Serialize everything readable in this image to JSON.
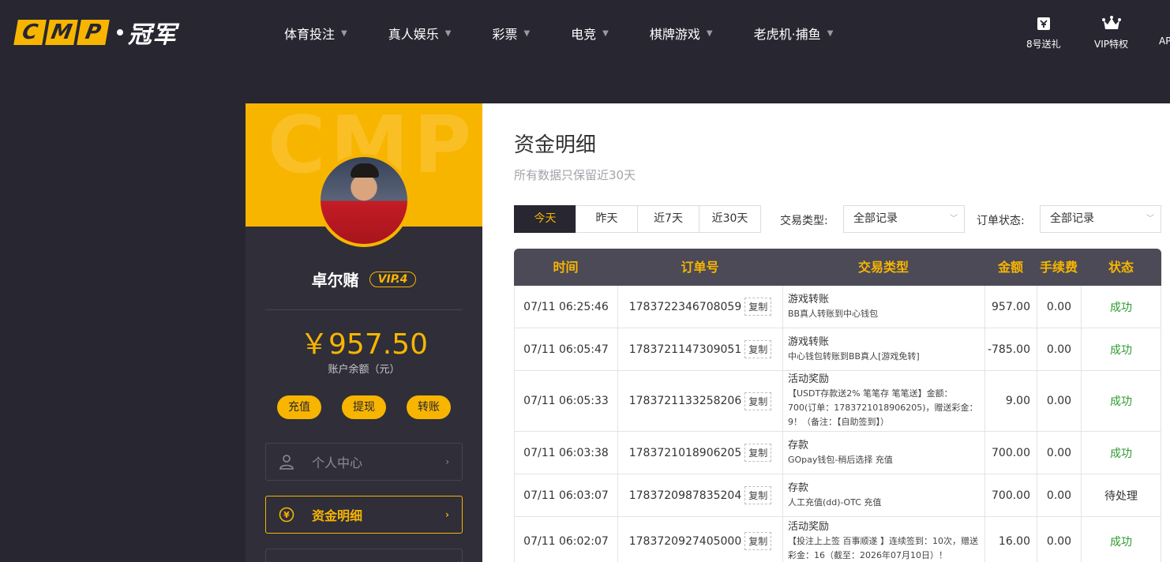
{
  "header": {
    "logo_letters": [
      "C",
      "M",
      "P"
    ],
    "logo_cn": "冠军",
    "nav": [
      {
        "label": "体育投注"
      },
      {
        "label": "真人娱乐"
      },
      {
        "label": "彩票"
      },
      {
        "label": "电竞"
      },
      {
        "label": "棋牌游戏"
      },
      {
        "label": "老虎机·捕鱼"
      }
    ],
    "icons": [
      {
        "label": "8号送礼",
        "icon": "gift-ticket-icon"
      },
      {
        "label": "VIP特权",
        "icon": "crown-icon"
      },
      {
        "label": "AP",
        "icon": "app-icon"
      }
    ]
  },
  "profile": {
    "banner_watermark": "CMP",
    "username": "卓尔赌",
    "vip": "VIP.4",
    "balance": "￥957.50",
    "balance_label": "账户余额（元）",
    "actions": [
      "充值",
      "提现",
      "转账"
    ],
    "menu": [
      {
        "label": "个人中心",
        "icon": "user-icon",
        "active": false
      },
      {
        "label": "资金明细",
        "icon": "yen-coin-icon",
        "active": true
      }
    ]
  },
  "main": {
    "title": "资金明细",
    "subtitle": "所有数据只保留近30天",
    "date_tabs": [
      "今天",
      "昨天",
      "近7天",
      "近30天"
    ],
    "active_tab": 0,
    "filters": {
      "type_label": "交易类型:",
      "type_value": "全部记录",
      "status_label": "订单状态:",
      "status_value": "全部记录"
    },
    "table": {
      "headers": [
        "时间",
        "订单号",
        "交易类型",
        "金额",
        "手续费",
        "状态"
      ],
      "copy_label": "复制",
      "rows": [
        {
          "time": "07/11 06:25:46",
          "order": "1783722346708059",
          "type": "游戏转账",
          "desc": "BB真人转账到中心钱包",
          "amount": "957.00",
          "fee": "0.00",
          "status": "成功",
          "status_kind": "ok"
        },
        {
          "time": "07/11 06:05:47",
          "order": "1783721147309051",
          "type": "游戏转账",
          "desc": "中心钱包转账到BB真人[游戏免转]",
          "amount": "-785.00",
          "fee": "0.00",
          "status": "成功",
          "status_kind": "ok"
        },
        {
          "time": "07/11 06:05:33",
          "order": "1783721133258206",
          "type": "活动奖励",
          "desc": "【USDT存款送2% 笔笔存 笔笔送】金额：700(订单：1783721018906205)，赠送彩金：9！（备注：【自助签到】）",
          "amount": "9.00",
          "fee": "0.00",
          "status": "成功",
          "status_kind": "ok"
        },
        {
          "time": "07/11 06:03:38",
          "order": "1783721018906205",
          "type": "存款",
          "desc": "GOpay钱包-稍后选择 充值",
          "amount": "700.00",
          "fee": "0.00",
          "status": "成功",
          "status_kind": "ok"
        },
        {
          "time": "07/11 06:03:07",
          "order": "1783720987835204",
          "type": "存款",
          "desc": "人工充值(dd)-OTC 充值",
          "amount": "700.00",
          "fee": "0.00",
          "status": "待处理",
          "status_kind": "pending"
        },
        {
          "time": "07/11 06:02:07",
          "order": "1783720927405000",
          "type": "活动奖励",
          "desc": "【投注上上签 百事顺遂 】连续签到：10次，赠送彩金：16（截至：2026年07月10日）！",
          "amount": "16.00",
          "fee": "0.00",
          "status": "成功",
          "status_kind": "ok"
        }
      ]
    }
  },
  "colors": {
    "accent": "#f8b500",
    "dark_bg": "#272631",
    "panel_bg": "#2f2e39",
    "table_header_bg": "#4b4a56",
    "success": "#2f9a2f"
  }
}
